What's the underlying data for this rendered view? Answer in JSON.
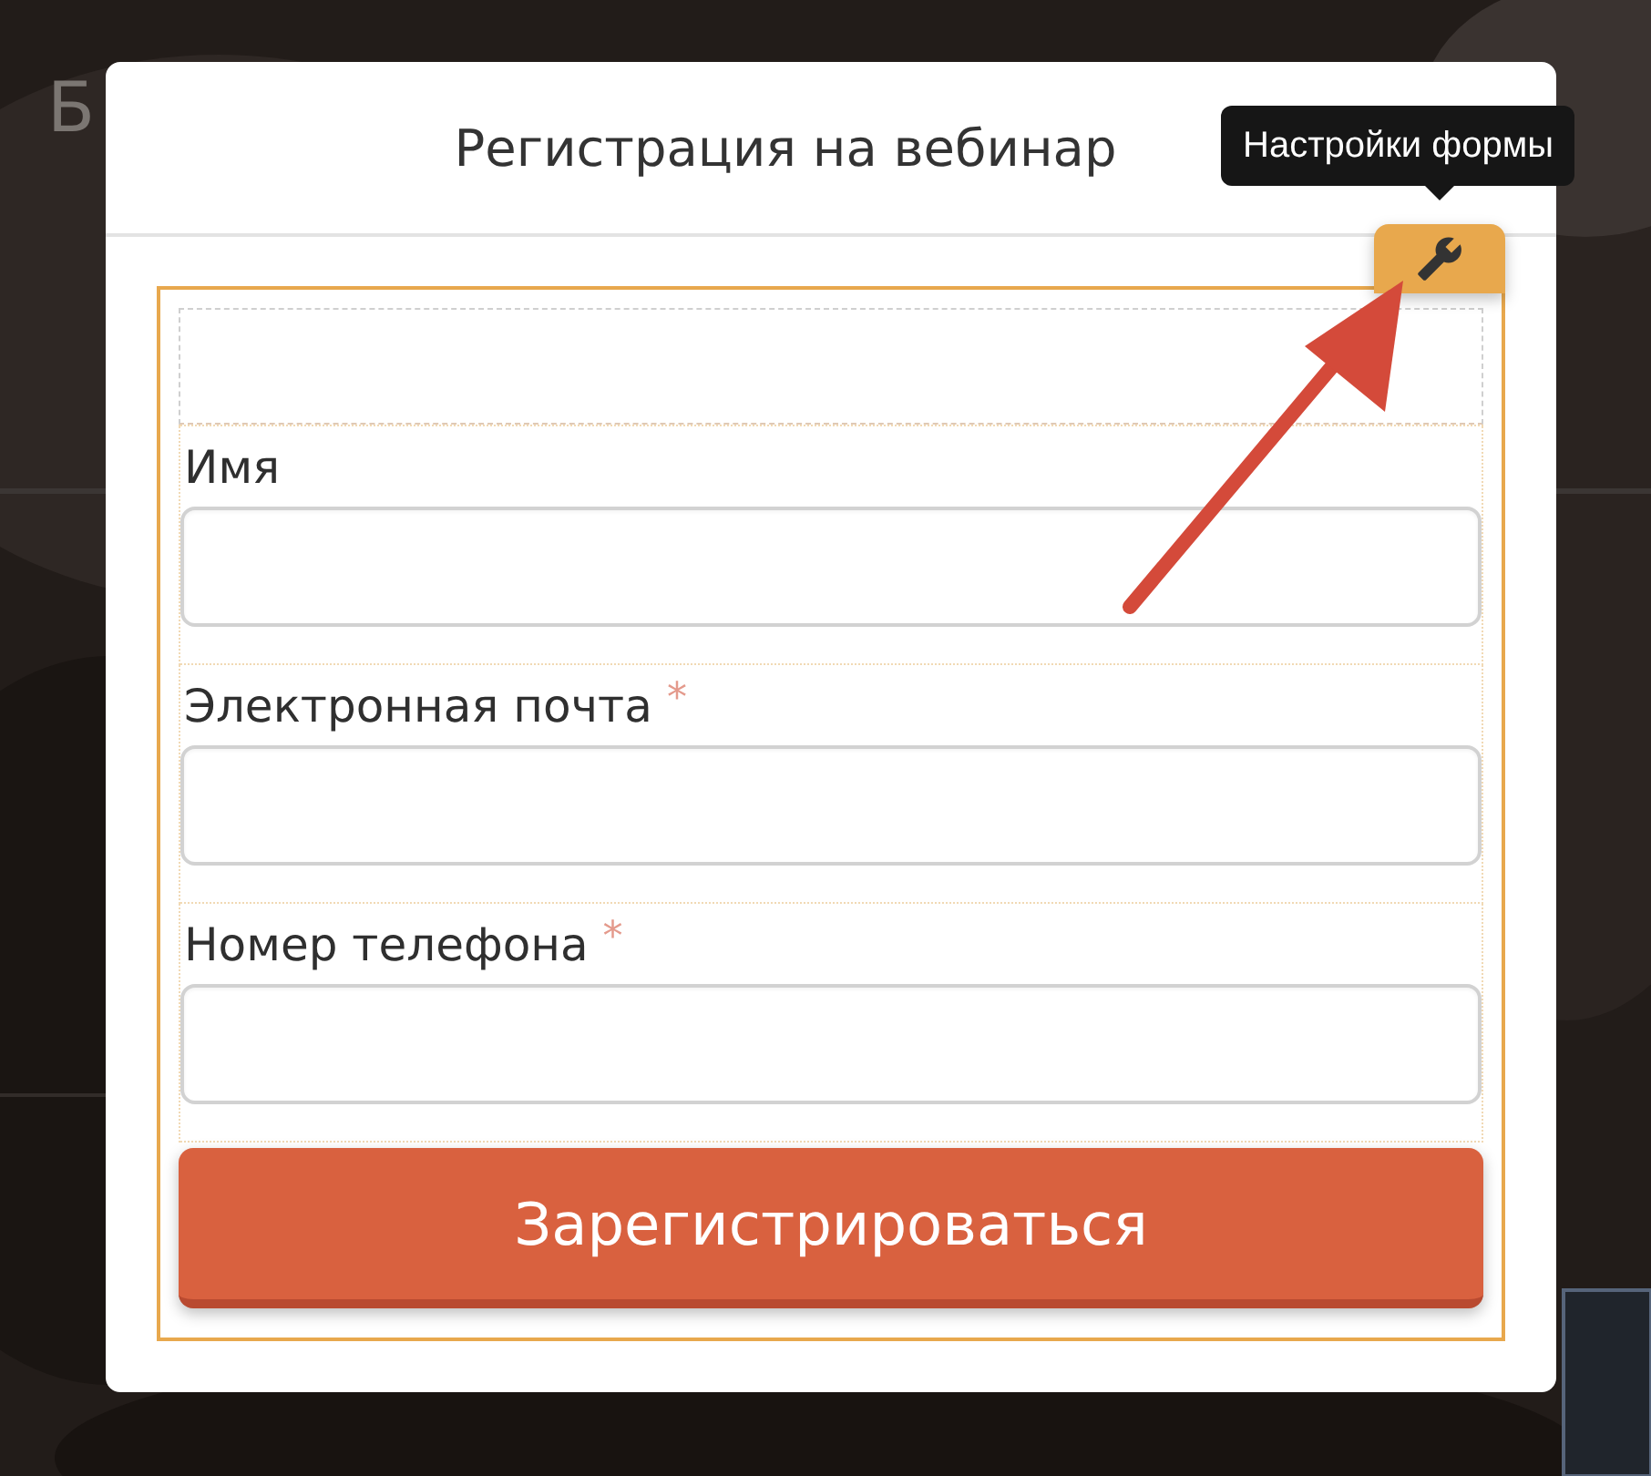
{
  "background": {
    "heading": "Б"
  },
  "dialog": {
    "title": "Регистрация на вебинар"
  },
  "tooltip": {
    "text": "Настройки формы"
  },
  "form": {
    "required_mark": "*",
    "fields": [
      {
        "label": "Имя",
        "required": false
      },
      {
        "label": "Электронная почта",
        "required": true
      },
      {
        "label": "Номер телефона",
        "required": true
      }
    ],
    "submit": {
      "label": "Зарегистрироваться"
    }
  }
}
